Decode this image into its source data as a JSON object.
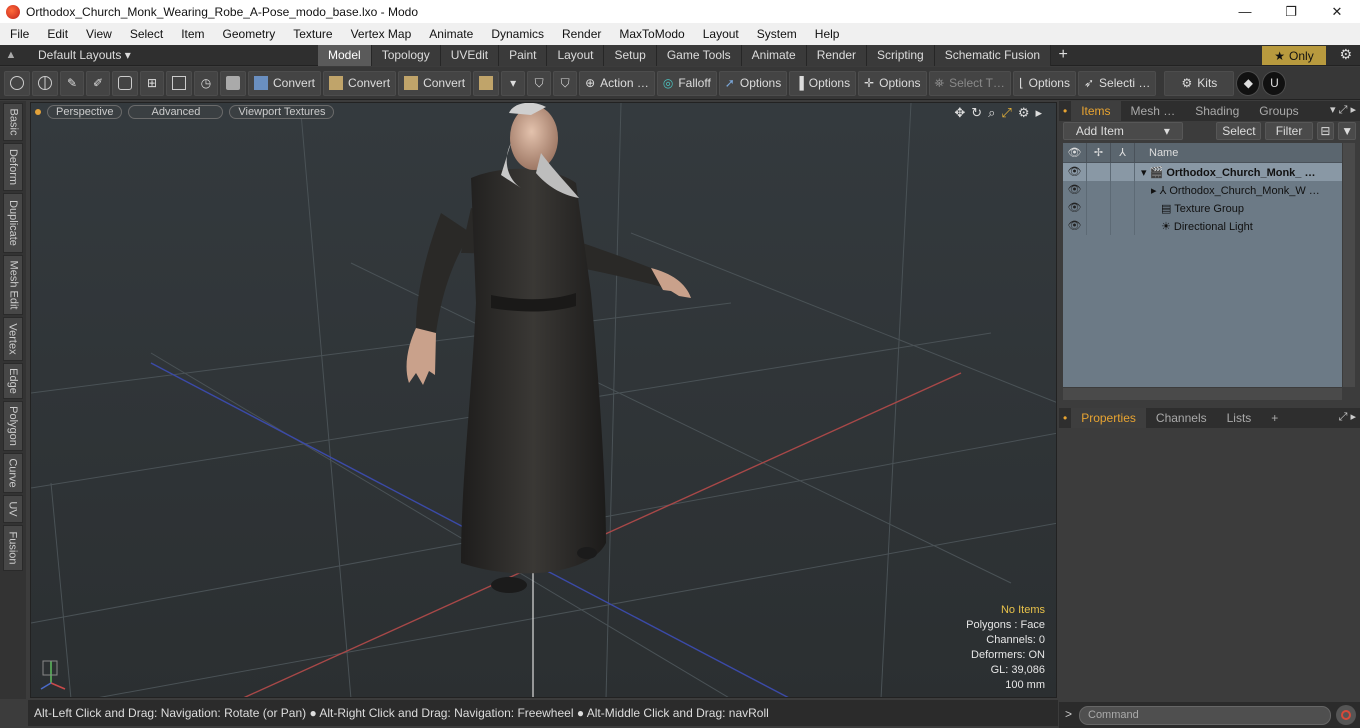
{
  "window": {
    "title": "Orthodox_Church_Monk_Wearing_Robe_A-Pose_modo_base.lxo - Modo",
    "minimize": "—",
    "maximize": "❐",
    "close": "✕"
  },
  "menu": [
    "File",
    "Edit",
    "View",
    "Select",
    "Item",
    "Geometry",
    "Texture",
    "Vertex Map",
    "Animate",
    "Dynamics",
    "Render",
    "MaxToModo",
    "Layout",
    "System",
    "Help"
  ],
  "layoutbar": {
    "layouts_label": "Default Layouts ▾",
    "tabs": [
      "Model",
      "Topology",
      "UVEdit",
      "Paint",
      "Layout",
      "Setup",
      "Game Tools",
      "Animate",
      "Render",
      "Scripting",
      "Schematic Fusion"
    ],
    "active_tab": "Model",
    "add": "+",
    "only_label": "Only",
    "star": "★"
  },
  "toolbar": {
    "convert1": "Convert",
    "convert2": "Convert",
    "convert3": "Convert",
    "action": "Action …",
    "falloff": "Falloff",
    "options1": "Options",
    "options2": "Options",
    "options3": "Options",
    "select_t": "Select T…",
    "options4": "Options",
    "selecti": "Selecti …",
    "kits": "Kits"
  },
  "left_tabs": [
    "Basic",
    "Deform",
    "Duplicate",
    "Mesh Edit",
    "Vertex",
    "Edge",
    "Polygon",
    "Curve",
    "UV",
    "Fusion"
  ],
  "viewport": {
    "view_mode": "Perspective",
    "shading": "Advanced",
    "textures": "Viewport Textures",
    "stats": {
      "selection": "No Items",
      "polygons": "Polygons : Face",
      "channels": "Channels: 0",
      "deformers": "Deformers: ON",
      "gl": "GL: 39,086",
      "scale": "100 mm"
    }
  },
  "statusbar": {
    "text": "Alt-Left Click and Drag: Navigation: Rotate (or Pan) ● Alt-Right Click and Drag: Navigation: Freewheel ● Alt-Middle Click and Drag: navRoll"
  },
  "right_panel": {
    "tabs": [
      "Items",
      "Mesh …",
      "Shading",
      "Groups"
    ],
    "active_tab": "Items",
    "add_item": "Add Item",
    "select": "Select",
    "filter": "Filter",
    "name_header": "Name",
    "items": [
      {
        "name": "Orthodox_Church_Monk_ …",
        "depth": 0,
        "icon": "scene-icon",
        "bold": true
      },
      {
        "name": "Orthodox_Church_Monk_W …",
        "depth": 1,
        "icon": "mesh-icon",
        "bold": false
      },
      {
        "name": "Texture Group",
        "depth": 1,
        "icon": "texture-group-icon",
        "bold": false
      },
      {
        "name": "Directional Light",
        "depth": 1,
        "icon": "light-icon",
        "bold": false
      }
    ],
    "prop_tabs": [
      "Properties",
      "Channels",
      "Lists"
    ],
    "prop_active": "Properties",
    "command_placeholder": "Command"
  },
  "colors": {
    "accent": "#e8a431",
    "only_button": "#b89a3e",
    "viewport_bg": "#2d3235",
    "items_bg": "#6c7a86"
  }
}
